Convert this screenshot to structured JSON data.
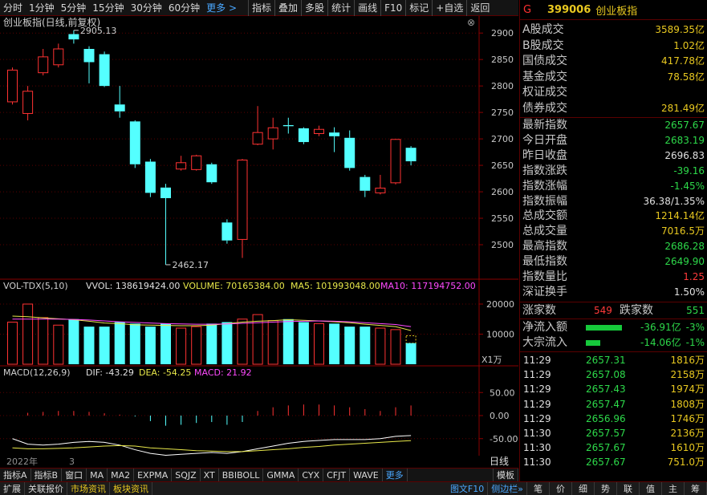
{
  "toolbar": {
    "left": [
      "分时",
      "1分钟",
      "5分钟",
      "15分钟",
      "30分钟",
      "60分钟"
    ],
    "more": "更多 >",
    "right": [
      "指标",
      "叠加",
      "多股",
      "统计",
      "画线",
      "F10",
      "标记",
      "+自选",
      "返回"
    ]
  },
  "chart": {
    "title": "创业板指(日线,前复权)",
    "high_label": "2905.13",
    "low_label": "2462.17",
    "price_axis": [
      "2900",
      "2850",
      "2800",
      "2750",
      "2700",
      "2650",
      "2600",
      "2550",
      "2500"
    ],
    "vol_title": "VOL-TDX(5,10)",
    "vol_vvol": "VVOL: 138619424.00",
    "vol_volume": "VOLUME: 70165384.00",
    "vol_ma5": "MA5: 101993048.00",
    "vol_ma10": "MA10: 117194752.00",
    "vol_axis": [
      "20000",
      "10000"
    ],
    "vol_unit": "X1万",
    "macd_title": "MACD(12,26,9)",
    "macd_dif": "DIF: -43.29",
    "macd_dea": "DEA: -54.25",
    "macd_macd": "MACD: 21.92",
    "macd_axis": [
      "50.00",
      "0.00",
      "-50.00"
    ],
    "date_year": "2022年",
    "date_month": "3",
    "period": "日线",
    "colors": {
      "up": "#ff3232",
      "down": "#54ffff",
      "ma5": "#e8e84a",
      "ma10": "#ff4aff",
      "dif": "#ffffff",
      "dea": "#e8e84a"
    }
  },
  "chart_data": {
    "type": "candlestick",
    "ylim": [
      2450,
      2920
    ],
    "candles": [
      {
        "o": 2770,
        "c": 2830,
        "h": 2835,
        "l": 2765
      },
      {
        "o": 2748,
        "c": 2790,
        "h": 2800,
        "l": 2735
      },
      {
        "o": 2825,
        "c": 2855,
        "h": 2870,
        "l": 2820
      },
      {
        "o": 2840,
        "c": 2870,
        "h": 2880,
        "l": 2835
      },
      {
        "o": 2898,
        "c": 2888,
        "h": 2905.13,
        "l": 2880
      },
      {
        "o": 2870,
        "c": 2845,
        "h": 2875,
        "l": 2805
      },
      {
        "o": 2860,
        "c": 2800,
        "h": 2865,
        "l": 2798
      },
      {
        "o": 2765,
        "c": 2752,
        "h": 2800,
        "l": 2740
      },
      {
        "o": 2733,
        "c": 2652,
        "h": 2735,
        "l": 2645
      },
      {
        "o": 2657,
        "c": 2598,
        "h": 2662,
        "l": 2590
      },
      {
        "o": 2608,
        "c": 2588,
        "h": 2615,
        "l": 2462.17
      },
      {
        "o": 2643,
        "c": 2655,
        "h": 2668,
        "l": 2640
      },
      {
        "o": 2642,
        "c": 2668,
        "h": 2670,
        "l": 2640
      },
      {
        "o": 2652,
        "c": 2618,
        "h": 2655,
        "l": 2615
      },
      {
        "o": 2542,
        "c": 2508,
        "h": 2548,
        "l": 2502
      },
      {
        "o": 2510,
        "c": 2660,
        "h": 2662,
        "l": 2475
      },
      {
        "o": 2690,
        "c": 2712,
        "h": 2762,
        "l": 2688
      },
      {
        "o": 2700,
        "c": 2721,
        "h": 2740,
        "l": 2680
      },
      {
        "o": 2726,
        "c": 2724,
        "h": 2740,
        "l": 2710
      },
      {
        "o": 2720,
        "c": 2694,
        "h": 2722,
        "l": 2690
      },
      {
        "o": 2710,
        "c": 2718,
        "h": 2725,
        "l": 2705
      },
      {
        "o": 2712,
        "c": 2705,
        "h": 2722,
        "l": 2675
      },
      {
        "o": 2702,
        "c": 2645,
        "h": 2716,
        "l": 2640
      },
      {
        "o": 2628,
        "c": 2602,
        "h": 2632,
        "l": 2590
      },
      {
        "o": 2598,
        "c": 2607,
        "h": 2632,
        "l": 2595
      },
      {
        "o": 2617,
        "c": 2699,
        "h": 2700,
        "l": 2614
      },
      {
        "o": 2683.19,
        "c": 2657.67,
        "h": 2686.28,
        "l": 2649.9
      }
    ],
    "volume": {
      "ylim": [
        0,
        24000
      ],
      "values": [
        14000,
        20000,
        15500,
        13000,
        15000,
        12500,
        12500,
        14000,
        13500,
        12500,
        13500,
        12000,
        12500,
        13500,
        14000,
        15000,
        16500,
        14500,
        15000,
        14000,
        13500,
        13500,
        12500,
        12500,
        12000,
        11500,
        7000
      ],
      "ma5": [
        16000,
        15800,
        15400,
        15100,
        14800,
        14300,
        13700,
        13500,
        13100,
        13000,
        12900,
        12800,
        12800,
        13000,
        13500,
        14000,
        14300,
        14500,
        14800,
        14600,
        14400,
        14100,
        13800,
        13300,
        12900,
        12500,
        11200
      ],
      "ma10": [
        15000,
        15000,
        15000,
        15000,
        14900,
        14700,
        14400,
        14100,
        13900,
        13700,
        13500,
        13400,
        13300,
        13300,
        13400,
        13600,
        13800,
        14000,
        14200,
        14300,
        14400,
        14300,
        14100,
        13800,
        13500,
        13200,
        12500
      ]
    },
    "macd": {
      "ylim": [
        -80,
        80
      ],
      "hist": [
        0,
        6,
        8,
        10,
        10,
        8,
        5,
        2,
        -2,
        -12,
        -22,
        -20,
        -16,
        -14,
        -20,
        -14,
        10,
        18,
        22,
        24,
        24,
        22,
        18,
        14,
        10,
        18,
        21.92
      ],
      "dif": [
        -50,
        -62,
        -64,
        -62,
        -58,
        -56,
        -58,
        -64,
        -74,
        -82,
        -86,
        -84,
        -82,
        -80,
        -82,
        -78,
        -72,
        -66,
        -60,
        -56,
        -54,
        -52,
        -52,
        -52,
        -50,
        -45,
        -43.29
      ],
      "dea": [
        -70,
        -72,
        -72,
        -71,
        -70,
        -68,
        -66,
        -65,
        -66,
        -70,
        -72,
        -74,
        -76,
        -77,
        -78,
        -78,
        -76,
        -74,
        -72,
        -69,
        -67,
        -64,
        -62,
        -60,
        -58,
        -56,
        -54.25
      ]
    }
  },
  "bottom_tabs": {
    "items": [
      "指标A",
      "指标B",
      "窗口",
      "MA",
      "MA2",
      "EXPMA",
      "SQJZ",
      "XT",
      "BBIBOLL",
      "GMMA",
      "CYX",
      "CFJT",
      "WAVE"
    ],
    "more": "更多",
    "tail": "模板"
  },
  "footer": {
    "items": [
      "扩展",
      "关联报价",
      "市场资讯",
      "板块资讯"
    ],
    "right1": "图文F10",
    "right2": "侧边栏»",
    "tabs": [
      "笔",
      "价",
      "细",
      "势",
      "联",
      "值",
      "主",
      "筹"
    ]
  },
  "quote": {
    "prefix": "G",
    "code": "399006",
    "name": "创业板指",
    "rows": [
      {
        "label": "A股成交",
        "value": "3589.35亿",
        "color": "yellow"
      },
      {
        "label": "B股成交",
        "value": "1.02亿",
        "color": "yellow"
      },
      {
        "label": "国债成交",
        "value": "417.78亿",
        "color": "yellow"
      },
      {
        "label": "基金成交",
        "value": "78.58亿",
        "color": "yellow"
      },
      {
        "label": "权证成交",
        "value": "",
        "color": "yellow"
      },
      {
        "label": "债券成交",
        "value": "281.49亿",
        "color": "yellow"
      }
    ],
    "rows2": [
      {
        "label": "最新指数",
        "value": "2657.67",
        "color": "green"
      },
      {
        "label": "今日开盘",
        "value": "2683.19",
        "color": "green"
      },
      {
        "label": "昨日收盘",
        "value": "2696.83",
        "color": "white"
      },
      {
        "label": "指数涨跌",
        "value": "-39.16",
        "color": "green"
      },
      {
        "label": "指数涨幅",
        "value": "-1.45%",
        "color": "green"
      },
      {
        "label": "指数振幅",
        "value": "36.38/1.35%",
        "color": "white"
      },
      {
        "label": "总成交额",
        "value": "1214.14亿",
        "color": "yellow"
      },
      {
        "label": "总成交量",
        "value": "7016.5万",
        "color": "yellow"
      },
      {
        "label": "最高指数",
        "value": "2686.28",
        "color": "green"
      },
      {
        "label": "最低指数",
        "value": "2649.90",
        "color": "green"
      },
      {
        "label": "指数量比",
        "value": "1.25",
        "color": "red"
      },
      {
        "label": "深证换手",
        "value": "1.50%",
        "color": "white"
      }
    ],
    "rise_label": "涨家数",
    "rise_value": "549",
    "fall_label": "跌家数",
    "fall_value": "551",
    "flow": [
      {
        "label": "净流入额",
        "value": "-36.91亿",
        "pct": "-3%",
        "bar": 0.75
      },
      {
        "label": "大宗流入",
        "value": "-14.06亿",
        "pct": "-1%",
        "bar": 0.3
      }
    ],
    "ticks": [
      {
        "t": "11:29",
        "p": "2657.31",
        "v": "1816万"
      },
      {
        "t": "11:29",
        "p": "2657.08",
        "v": "2158万"
      },
      {
        "t": "11:29",
        "p": "2657.43",
        "v": "1974万"
      },
      {
        "t": "11:29",
        "p": "2657.47",
        "v": "1808万"
      },
      {
        "t": "11:29",
        "p": "2656.96",
        "v": "1746万"
      },
      {
        "t": "11:30",
        "p": "2657.57",
        "v": "2136万"
      },
      {
        "t": "11:30",
        "p": "2657.67",
        "v": "1610万"
      },
      {
        "t": "11:30",
        "p": "2657.67",
        "v": "751.0万"
      }
    ]
  }
}
